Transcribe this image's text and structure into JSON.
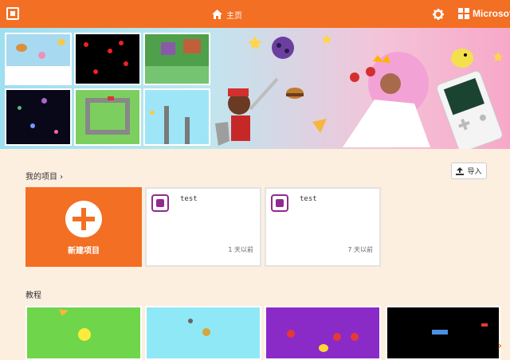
{
  "header": {
    "home_label": "主页",
    "brand": "Microsoft",
    "brand_color": "#f36f24",
    "icons": [
      "makecode-logo-icon",
      "home-icon",
      "gear-icon",
      "microsoft-logo-icon"
    ]
  },
  "my_projects": {
    "title": "我的项目 ›",
    "import_label": "导入",
    "new_project_label": "新建项目",
    "projects": [
      {
        "name": "test",
        "time": "1 天以前"
      },
      {
        "name": "test",
        "time": "7 天以前"
      }
    ]
  },
  "tutorials": {
    "title": "教程"
  }
}
